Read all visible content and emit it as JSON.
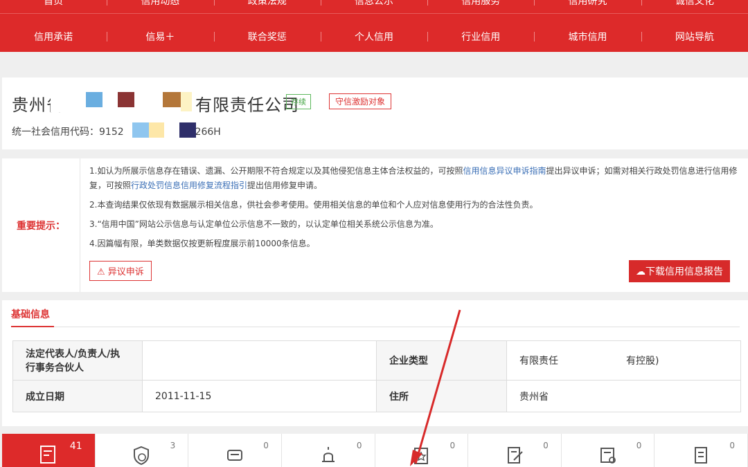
{
  "nav": {
    "row1": [
      "首页",
      "信用动态",
      "政策法规",
      "信息公示",
      "信用服务",
      "信用研究",
      "诚信文化"
    ],
    "row2": [
      "信用承诺",
      "信易＋",
      "联合奖惩",
      "个人信用",
      "行业信用",
      "城市信用",
      "网站导航"
    ]
  },
  "company": {
    "name_start": "贵州省",
    "name_end": "有限责任公司",
    "status_tag": "存续",
    "incentive_tag": "守信激励对象",
    "code_label": "统一社会信用代码：",
    "code_start": "9152",
    "code_end": "5266H"
  },
  "notice": {
    "label": "重要提示：",
    "item1_a": "1.如认为所展示信息存在错误、遗漏、公开期限不符合规定以及其他侵犯信息主体合法权益的，可按照",
    "item1_link1": "信用信息异议申诉指南",
    "item1_b": "提出异议申诉；如需对相关行政处罚信息进行信用修复，可按照",
    "item1_link2": "行政处罚信息信用修复流程指引",
    "item1_c": "提出信用修复申请。",
    "item2": "2.本查询结果仅依现有数据展示相关信息，供社会参考使用。使用相关信息的单位和个人应对信息使用行为的合法性负责。",
    "item3": "3.“信用中国”网站公示信息与认定单位公示信息不一致的，以认定单位相关系统公示信息为准。",
    "item4": "4.因篇幅有限，单类数据仅按更新程度展示前10000条信息。",
    "objection_btn": "异议申诉",
    "download_btn": "下载信用信息报告"
  },
  "basic": {
    "title": "基础信息",
    "rows": [
      {
        "k1": "法定代表人/负责人/执行事务合伙人",
        "v1": "",
        "k2": "企业类型",
        "v2": "有限责任公司（自然人投资或控股）"
      },
      {
        "k1": "成立日期",
        "v1": "2011-11-15",
        "k2": "住所",
        "v2": "贵州省"
      }
    ]
  },
  "tabs": [
    {
      "icon": "document-icon",
      "count": "41"
    },
    {
      "icon": "shield-credit-icon",
      "count": "3"
    },
    {
      "icon": "dishonest-car-icon",
      "count": "0"
    },
    {
      "icon": "alarm-icon",
      "count": "0"
    },
    {
      "icon": "star-certificate-icon",
      "count": "0"
    },
    {
      "icon": "signed-document-icon",
      "count": "0"
    },
    {
      "icon": "review-document-icon",
      "count": "0"
    },
    {
      "icon": "ledger-icon",
      "count": "0"
    }
  ],
  "colors": {
    "brand_red": "#dd2a2a",
    "link_blue": "#3b6fb6",
    "status_green": "#46a546"
  }
}
